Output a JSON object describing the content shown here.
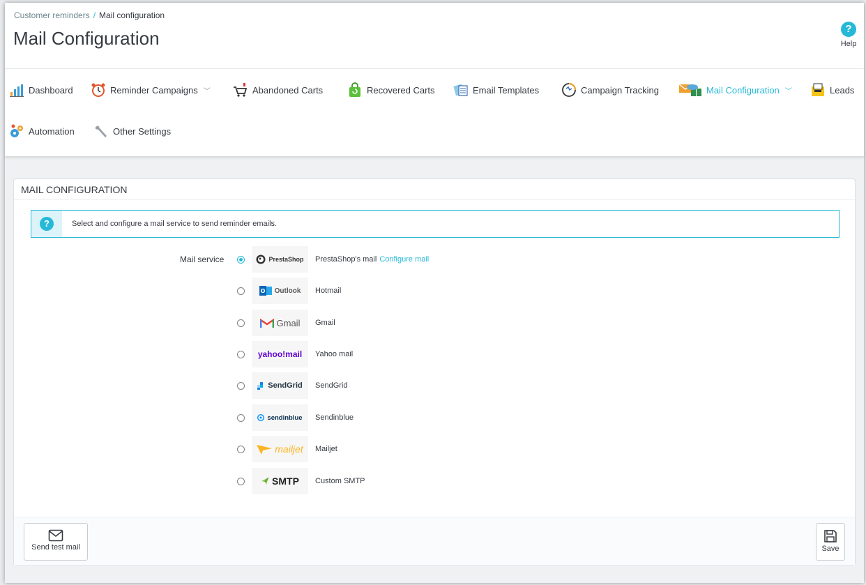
{
  "breadcrumb": {
    "parent": "Customer reminders",
    "separator": "/",
    "current": "Mail configuration"
  },
  "page_title": "Mail Configuration",
  "help": {
    "icon": "?",
    "label": "Help"
  },
  "tabs": [
    {
      "label": "Dashboard",
      "icon": "bar-chart-icon"
    },
    {
      "label": "Reminder Campaigns",
      "icon": "alarm-clock-icon",
      "dropdown": "﹀"
    },
    {
      "label": "Abandoned Carts",
      "icon": "shopping-cart-icon"
    },
    {
      "label": "Recovered Carts",
      "icon": "shopping-bag-icon"
    },
    {
      "label": "Email Templates",
      "icon": "templates-icon"
    },
    {
      "label": "Campaign Tracking",
      "icon": "tracking-icon"
    },
    {
      "label": "Mail Configuration",
      "icon": "mail-server-icon",
      "dropdown": "﹀",
      "active": true
    },
    {
      "label": "Leads",
      "icon": "leads-icon"
    },
    {
      "label": "Automation",
      "icon": "gears-icon"
    },
    {
      "label": "Other Settings",
      "icon": "wrench-icon"
    }
  ],
  "panel": {
    "heading": "MAIL CONFIGURATION",
    "info_icon": "?",
    "info_text": "Select and configure a mail service to send reminder emails.",
    "field_label": "Mail service",
    "services": [
      {
        "logo_text": "PrestaShop",
        "name": "PrestaShop's mail",
        "link": "Configure mail",
        "selected": true
      },
      {
        "logo_text": "Outlook",
        "name": "Hotmail",
        "selected": false
      },
      {
        "logo_text": "Gmail",
        "name": "Gmail",
        "selected": false
      },
      {
        "logo_text": "yahoo!mail",
        "name": "Yahoo mail",
        "selected": false
      },
      {
        "logo_text": "SendGrid",
        "name": "SendGrid",
        "selected": false
      },
      {
        "logo_text": "sendinblue",
        "name": "Sendinblue",
        "selected": false
      },
      {
        "logo_text": "mailjet",
        "name": "Mailjet",
        "selected": false
      },
      {
        "logo_text": "SMTP",
        "name": "Custom SMTP",
        "selected": false
      }
    ]
  },
  "footer": {
    "send_test": "Send test mail",
    "save": "Save"
  },
  "colors": {
    "accent": "#25b9d7",
    "text": "#363a41",
    "border": "#dbe0e3"
  }
}
